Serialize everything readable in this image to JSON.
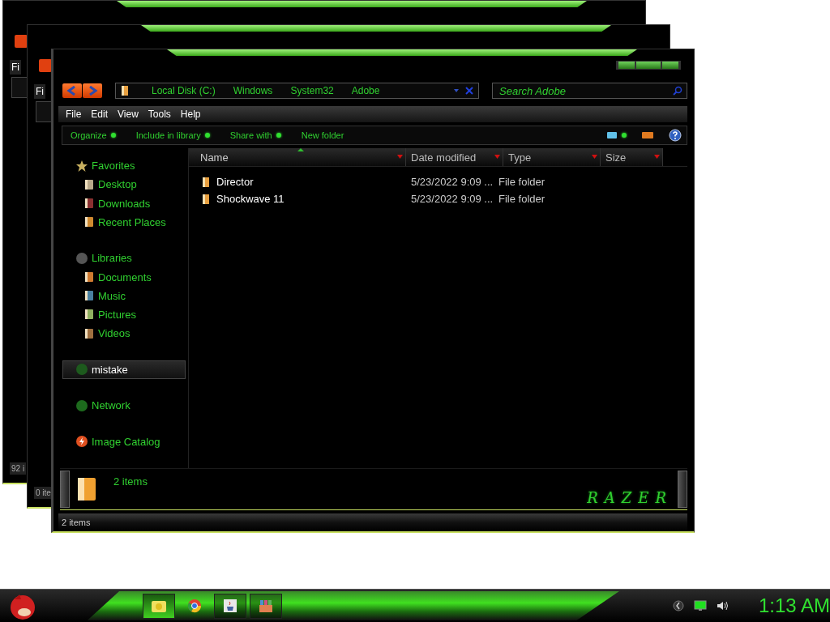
{
  "back_windows": [
    {
      "menu_fragment": "Fi",
      "status_fragment": "92 i"
    },
    {
      "menu_fragment": "Fi",
      "status_fragment": "0 ite"
    }
  ],
  "window": {
    "address": {
      "crumbs": [
        "Local Disk (C:)",
        "Windows",
        "System32",
        "Adobe"
      ]
    },
    "search": {
      "placeholder": "Search Adobe"
    },
    "menu": [
      "File",
      "Edit",
      "View",
      "Tools",
      "Help"
    ],
    "commands": [
      {
        "label": "Organize",
        "dropdown": true
      },
      {
        "label": "Include in library",
        "dropdown": true
      },
      {
        "label": "Share with",
        "dropdown": true
      },
      {
        "label": "New folder",
        "dropdown": false
      }
    ],
    "nav": [
      {
        "label": "Favorites",
        "kind": "star",
        "selected": false,
        "children": [
          {
            "label": "Desktop",
            "kind": "desktop",
            "selected": false
          },
          {
            "label": "Downloads",
            "kind": "download",
            "selected": false
          },
          {
            "label": "Recent Places",
            "kind": "recent",
            "selected": false
          }
        ]
      },
      {
        "label": "Libraries",
        "kind": "library",
        "selected": false,
        "children": [
          {
            "label": "Documents",
            "kind": "documents",
            "selected": false
          },
          {
            "label": "Music",
            "kind": "music",
            "selected": false
          },
          {
            "label": "Pictures",
            "kind": "pictures",
            "selected": false
          },
          {
            "label": "Videos",
            "kind": "videos",
            "selected": false
          }
        ]
      },
      {
        "label": "mistake",
        "kind": "computer",
        "selected": true
      },
      {
        "label": "Network",
        "kind": "network",
        "selected": false
      },
      {
        "label": "Image Catalog",
        "kind": "catalog",
        "selected": false
      }
    ],
    "columns": [
      {
        "label": "Name",
        "sorted": true
      },
      {
        "label": "Date modified",
        "sorted": false
      },
      {
        "label": "Type",
        "sorted": false
      },
      {
        "label": "Size",
        "sorted": false
      }
    ],
    "rows": [
      {
        "name": "Director",
        "date": "5/23/2022 9:09 ...",
        "type": "File folder"
      },
      {
        "name": "Shockwave 11",
        "date": "5/23/2022 9:09 ...",
        "type": "File folder"
      }
    ],
    "details": {
      "text": "2 items"
    },
    "logo": "RAZER",
    "status": "2 items"
  },
  "taskbar": {
    "apps": [
      {
        "kind": "folder",
        "selected": true,
        "running": true
      },
      {
        "kind": "browser",
        "selected": false,
        "running": false
      },
      {
        "kind": "java",
        "selected": false,
        "running": true
      },
      {
        "kind": "archive",
        "selected": false,
        "running": true
      }
    ],
    "clock": "1:13 AM"
  }
}
